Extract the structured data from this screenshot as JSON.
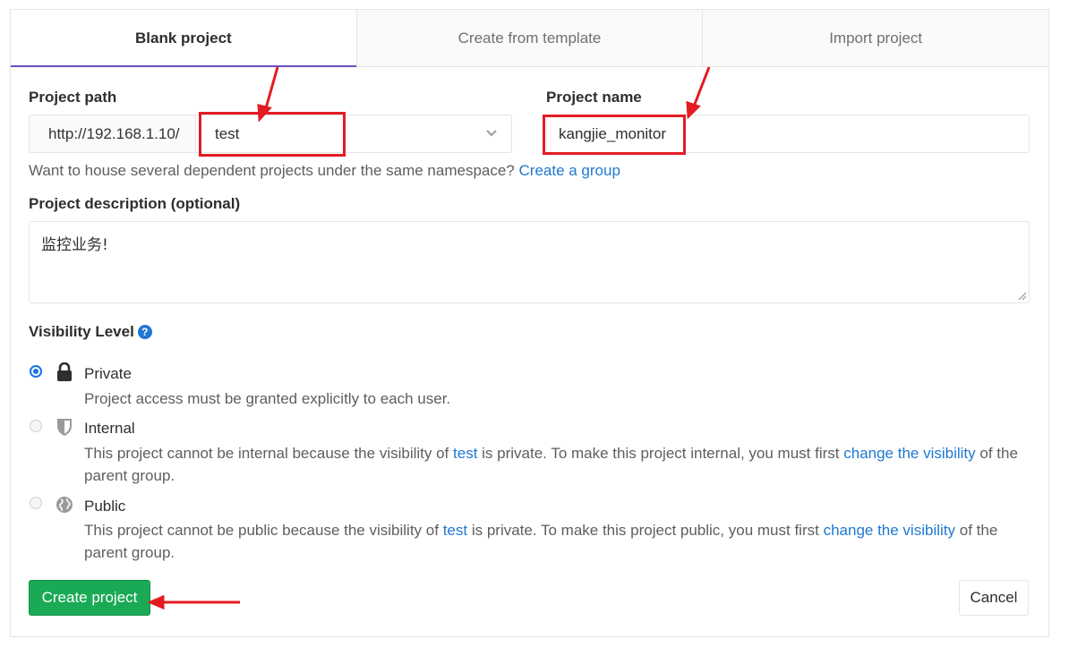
{
  "tabs": [
    {
      "label": "Blank project",
      "active": true
    },
    {
      "label": "Create from template",
      "active": false
    },
    {
      "label": "Import project",
      "active": false
    }
  ],
  "project_path": {
    "label": "Project path",
    "prefix": "http://192.168.1.10/",
    "namespace": "test"
  },
  "project_name": {
    "label": "Project name",
    "value": "kangjie_monitor"
  },
  "namespace_help": {
    "text": "Want to house several dependent projects under the same namespace?",
    "link": "Create a group"
  },
  "description": {
    "label": "Project description (optional)",
    "value": "监控业务!"
  },
  "visibility": {
    "label": "Visibility Level",
    "options": [
      {
        "title": "Private",
        "icon": "lock-icon",
        "checked": true,
        "desc": "Project access must be granted explicitly to each user."
      },
      {
        "title": "Internal",
        "icon": "shield-icon",
        "checked": false,
        "desc_1": "This project cannot be internal because the visibility of",
        "desc_link_1": "test",
        "desc_2": "is private. To make this project internal, you must first",
        "desc_link_2": "change the visibility",
        "desc_3": "of the parent group."
      },
      {
        "title": "Public",
        "icon": "globe-icon",
        "checked": false,
        "desc_1": "This project cannot be public because the visibility of",
        "desc_link_1": "test",
        "desc_2": "is private. To make this project public, you must first",
        "desc_link_2": "change the visibility",
        "desc_3": "of the parent group."
      }
    ]
  },
  "actions": {
    "create_label": "Create project",
    "cancel_label": "Cancel"
  },
  "colors": {
    "primary_button": "#1aaa55",
    "link": "#1f78d1",
    "annotation": "#e31b23",
    "active_tab_underline": "#6b4fbb"
  }
}
